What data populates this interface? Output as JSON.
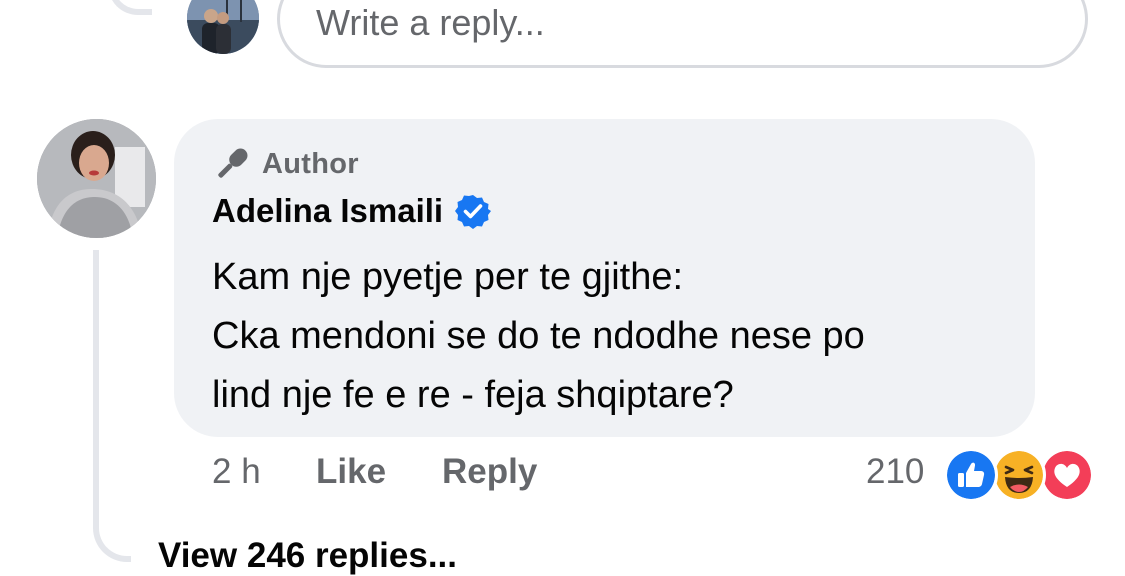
{
  "reply_composer": {
    "placeholder": "Write a reply..."
  },
  "comment": {
    "badge_label": "Author",
    "author_name": "Adelina Ismaili",
    "verified": true,
    "text_lines": [
      "Kam nje pyetje per te gjithe:",
      "Cka mendoni se do te ndodhe nese po",
      "lind nje fe e re - feja shqiptare?"
    ],
    "time": "2 h",
    "like_label": "Like",
    "reply_label": "Reply",
    "reaction_count": "210",
    "reactions": [
      "like-icon",
      "haha-icon",
      "love-icon"
    ]
  },
  "view_replies_label": "View 246 replies...",
  "colors": {
    "bubble": "#f0f2f5",
    "secondary_text": "#65676b",
    "verified_blue": "#1877f2",
    "like_blue": "#1877f2",
    "love_red": "#f33e58",
    "haha_yellow": "#f7b125"
  }
}
